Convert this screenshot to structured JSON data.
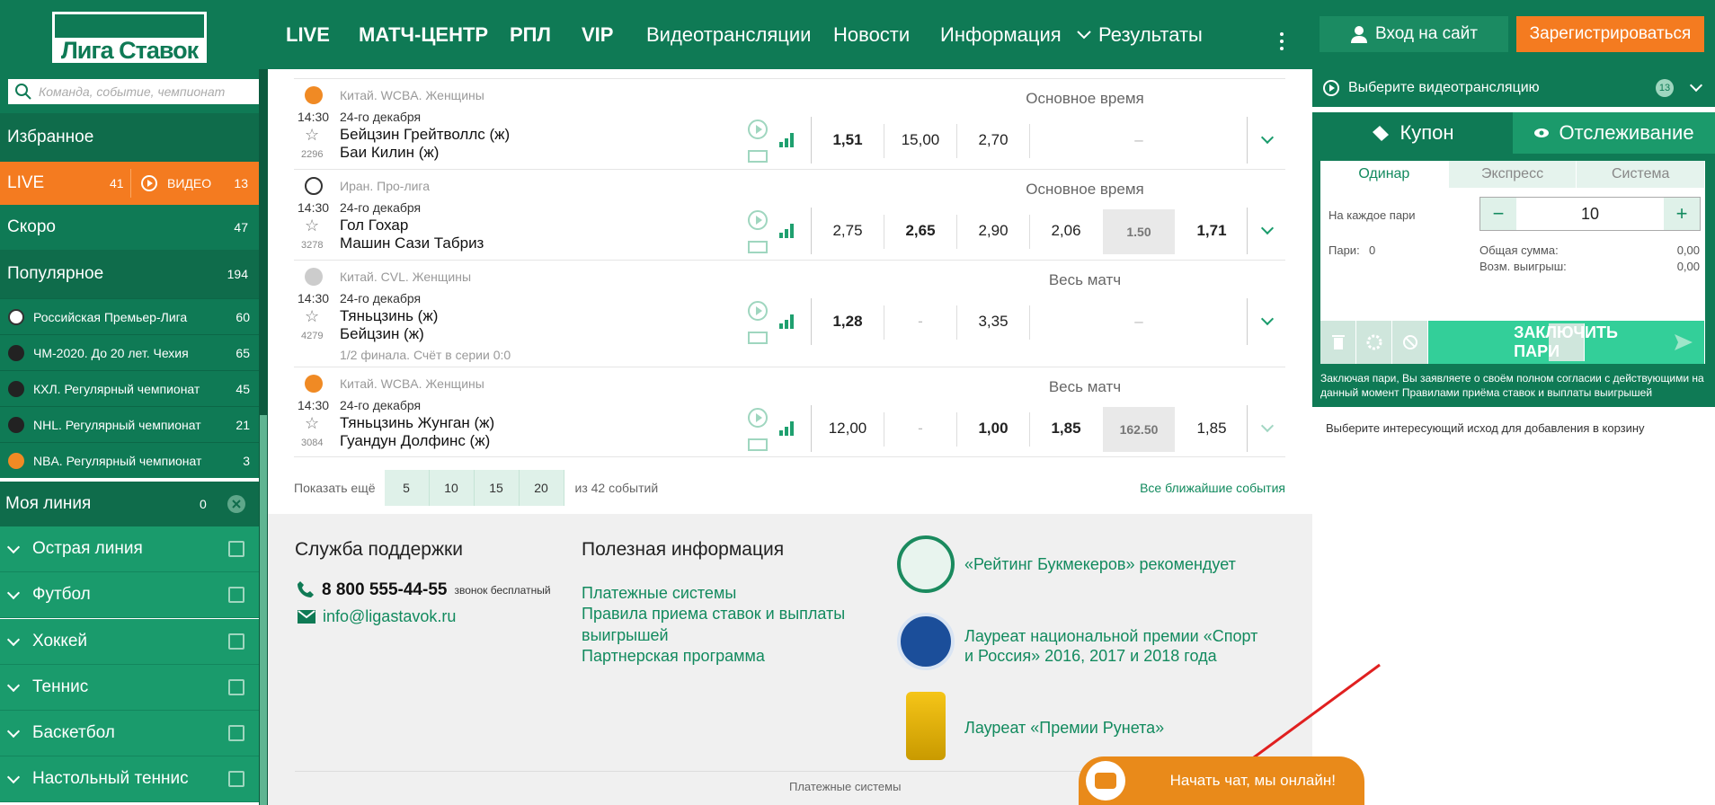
{
  "header": {
    "logo": "Лига Ставок",
    "nav": [
      "LIVE",
      "МАТЧ-ЦЕНТР",
      "РПЛ",
      "VIP",
      "Видеотрансляции",
      "Новости",
      "Информация",
      "Результаты"
    ],
    "login": "Вход на сайт",
    "register": "Зарегистрироваться"
  },
  "sidebar": {
    "search_placeholder": "Команда, событие, чемпионат",
    "favorites": "Избранное",
    "live": {
      "label": "LIVE",
      "count": "41",
      "video_label": "ВИДЕО",
      "video_count": "13"
    },
    "soon": {
      "label": "Скоро",
      "count": "47"
    },
    "popular": {
      "label": "Популярное",
      "count": "194"
    },
    "popular_items": [
      {
        "label": "Российская Премьер-Лига",
        "count": "60"
      },
      {
        "label": "ЧМ-2020. До 20 лет. Чехия",
        "count": "65"
      },
      {
        "label": "КХЛ. Регулярный чемпионат",
        "count": "45"
      },
      {
        "label": "NHL. Регулярный чемпионат",
        "count": "21"
      },
      {
        "label": "NBA. Регулярный чемпионат",
        "count": "3"
      }
    ],
    "my_line": {
      "label": "Моя линия",
      "count": "0"
    },
    "categories": [
      "Острая линия",
      "Футбол",
      "Хоккей",
      "Теннис",
      "Баскетбол",
      "Настольный теннис"
    ]
  },
  "events": [
    {
      "league": "Китай. WCBA. Женщины",
      "time": "14:30",
      "date": "24-го декабря",
      "team1": "Бейцзин Грейтволлс (ж)",
      "team2": "Баи Килин (ж)",
      "num": "2296",
      "market": "Основное время",
      "odds": [
        "1,51",
        "15,00",
        "2,70"
      ],
      "dash": "–"
    },
    {
      "league": "Иран. Про-лига",
      "time": "14:30",
      "date": "24-го декабря",
      "team1": "Гол Гохар",
      "team2": "Машин Сази Табриз",
      "num": "3278",
      "market": "Основное время",
      "odds": [
        "2,75",
        "2,65",
        "2,90",
        "2,06"
      ],
      "total": "1.50",
      "total_odd": "1,71"
    },
    {
      "league": "Китай. CVL. Женщины",
      "time": "14:30",
      "date": "24-го декабря",
      "team1": "Тяньцзинь (ж)",
      "team2": "Бейцзин (ж)",
      "num": "4279",
      "market": "Весь матч",
      "odds": [
        "1,28",
        "-",
        "3,35"
      ],
      "dash": "–",
      "extra": "1/2 финала. Счёт в серии 0:0"
    },
    {
      "league": "Китай. WCBA. Женщины",
      "time": "14:30",
      "date": "24-го декабря",
      "team1": "Тяньцзинь Жунган (ж)",
      "team2": "Гуандун Долфинс (ж)",
      "num": "3084",
      "market": "Весь матч",
      "odds": [
        "12,00",
        "-",
        "1,00",
        "1,85"
      ],
      "total": "162.50",
      "total_odd": "1,85"
    }
  ],
  "more": {
    "label": "Показать ещё",
    "pages": [
      "5",
      "10",
      "15",
      "20"
    ],
    "of": "из 42 событий",
    "all": "Все ближайшие события"
  },
  "footer": {
    "support_title": "Служба поддержки",
    "phone": "8 800 555-44-55",
    "phone_note": "звонок бесплатный",
    "email": "info@ligastavok.ru",
    "useful_title": "Полезная информация",
    "links": [
      "Платежные системы",
      "Правила приема ставок и выплаты выигрышей",
      "Партнерская программа"
    ],
    "awards": [
      "«Рейтинг Букмекеров» рекомендует",
      "Лауреат национальной премии «Спорт и Россия» 2016, 2017 и 2018 года",
      "Лауреат «Премии Рунета»"
    ],
    "bottom": "Платежные системы"
  },
  "chat": "Начать чат, мы онлайн!",
  "right": {
    "video": "Выберите видеотрансляцию",
    "video_count": "13",
    "tab_coupon": "Купон",
    "tab_track": "Отслеживание",
    "subtabs": [
      "Одинар",
      "Экспресс",
      "Система"
    ],
    "per_bet": "На каждое пари",
    "stake": "10",
    "bets_label": "Пари:",
    "bets_count": "0",
    "total_label": "Общая сумма:",
    "total_value": "0,00",
    "win_label": "Возм. выигрыш:",
    "win_value": "0,00",
    "place_bet": "ЗАКЛЮЧИТЬ ПАРИ",
    "terms": "Заключая пари, Вы заявляете о своём полном согласии с действующими на данный момент",
    "terms_link": "Правилами приёма ставок и выплаты выигрышей",
    "hint": "Выберите интересующий исход для добавления в корзину"
  },
  "colors": {
    "brand": "#0f7a55",
    "accent": "#f47b20",
    "link": "#128a5e"
  }
}
